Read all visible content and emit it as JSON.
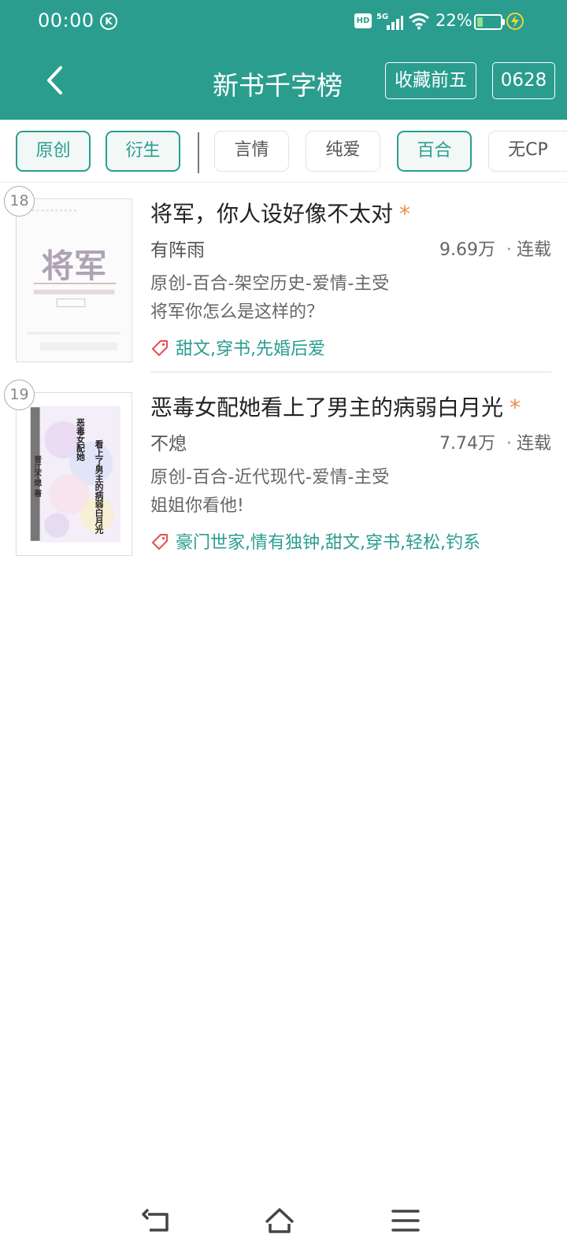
{
  "status_bar": {
    "time": "00:00",
    "k_badge": "K",
    "hd_badge": "HD",
    "network": "5G",
    "battery_percent": "22%",
    "battery_level": 0.22
  },
  "header": {
    "title": "新书千字榜",
    "top5_button": "收藏前五",
    "date_button": "0628",
    "colors": {
      "bar": "#2a9d8f",
      "accent": "#2a9d8f",
      "star": "#f08a4b",
      "tag_icon": "#e6504f"
    }
  },
  "filters": {
    "type_chips": [
      {
        "label": "原创",
        "active": true
      },
      {
        "label": "衍生",
        "active": true
      }
    ],
    "category_chips": [
      {
        "label": "言情",
        "active": false
      },
      {
        "label": "纯爱",
        "active": false
      },
      {
        "label": "百合",
        "active": true
      },
      {
        "label": "无CP",
        "active": false
      }
    ]
  },
  "books": [
    {
      "rank": "18",
      "title": "将军，你人设好像不太对",
      "star": "*",
      "author": "有阵雨",
      "count": "9.69万",
      "status": "连载",
      "genre": "原创-百合-架空历史-爱情-主受",
      "blurb": "将军你怎么是这样的？",
      "tags": "甜文,穿书,先婚后爱",
      "cover_text": "将军"
    },
    {
      "rank": "19",
      "title": "恶毒女配她看上了男主的病弱白月光",
      "star": "*",
      "author": "不熄",
      "count": "7.74万",
      "status": "连载",
      "genre": "原创-百合-近代现代-爱情-主受",
      "blurb": "姐姐你看他!",
      "tags": "豪门世家,情有独钟,甜文,穿书,轻松,钓系",
      "cover_text_line1": "恶毒女配她",
      "cover_text_line2": "看上了男主的病弱白月光",
      "cover_text_line3": "晋江不熄 著"
    }
  ]
}
